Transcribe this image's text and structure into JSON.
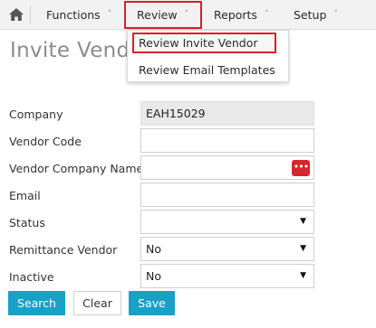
{
  "nav": {
    "home_icon": "home-icon",
    "items": [
      {
        "label": "Functions"
      },
      {
        "label": "Review"
      },
      {
        "label": "Reports"
      },
      {
        "label": "Setup"
      }
    ],
    "chevron": "˅",
    "highlight_color": "#d81e2a"
  },
  "dropdown": {
    "items": [
      {
        "label": "Review Invite Vendor"
      },
      {
        "label": "Review Email Templates"
      }
    ]
  },
  "page": {
    "title": "Invite Vendor"
  },
  "form": {
    "company": {
      "label": "Company",
      "value": "EAH15029"
    },
    "vendor_code": {
      "label": "Vendor Code",
      "value": ""
    },
    "vendor_company_name": {
      "label": "Vendor Company Name",
      "value": "",
      "lookup_icon": "more-dots-icon",
      "lookup_text": "•••"
    },
    "email": {
      "label": "Email",
      "value": ""
    },
    "status": {
      "label": "Status",
      "value": ""
    },
    "remittance_vendor": {
      "label": "Remittance Vendor",
      "value": "No"
    },
    "inactive": {
      "label": "Inactive",
      "value": "No"
    },
    "select_arrow": "▼"
  },
  "buttons": {
    "search": "Search",
    "clear": "Clear",
    "save": "Save",
    "primary_color": "#19a0c6"
  }
}
